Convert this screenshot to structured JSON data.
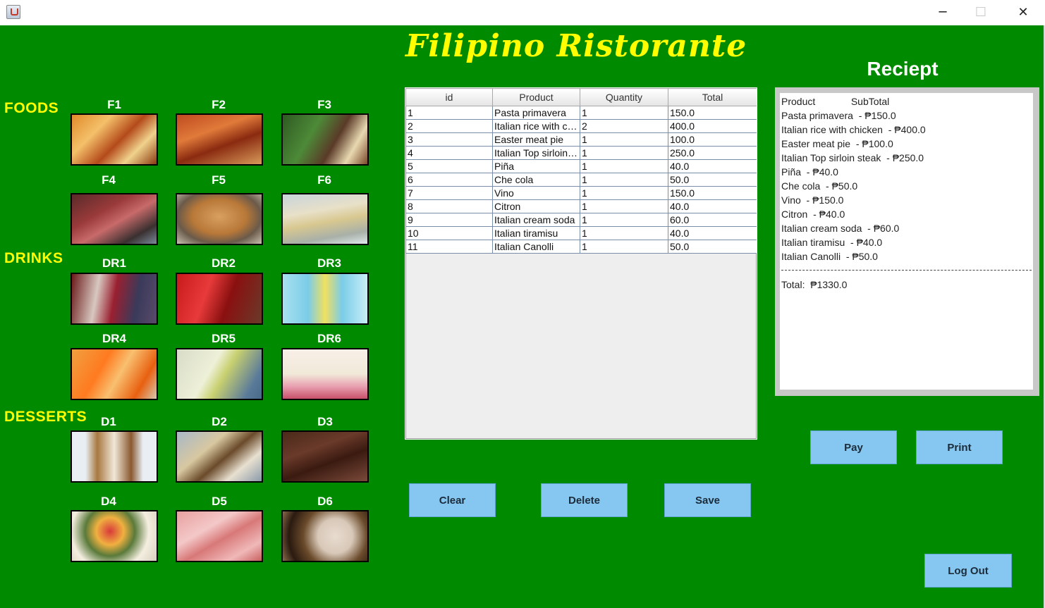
{
  "window": {
    "title": "",
    "min_icon": "─",
    "max_icon": "☐",
    "close_icon": "✕"
  },
  "app_title": "Filipino Ristorante",
  "sections": {
    "foods": "FOODS",
    "drinks": "DRINKS",
    "desserts": "DESSERTS"
  },
  "menu_items": [
    "F1",
    "F2",
    "F3",
    "F4",
    "F5",
    "F6",
    "DR1",
    "DR2",
    "DR3",
    "DR4",
    "DR5",
    "DR6",
    "D1",
    "D2",
    "D3",
    "D4",
    "D5",
    "D6"
  ],
  "table": {
    "columns": [
      "id",
      "Product",
      "Quantity",
      "Total"
    ],
    "rows": [
      [
        "1",
        "Pasta primavera",
        "1",
        "150.0"
      ],
      [
        "2",
        "Italian rice with ch...",
        "2",
        "400.0"
      ],
      [
        "3",
        "Easter meat pie",
        "1",
        "100.0"
      ],
      [
        "4",
        "Italian Top sirloin ...",
        "1",
        "250.0"
      ],
      [
        "5",
        "Piña",
        "1",
        "40.0"
      ],
      [
        "6",
        "Che cola",
        "1",
        "50.0"
      ],
      [
        "7",
        "Vino",
        "1",
        "150.0"
      ],
      [
        "8",
        "Citron",
        "1",
        "40.0"
      ],
      [
        "9",
        "Italian cream soda",
        "1",
        "60.0"
      ],
      [
        "10",
        "Italian tiramisu",
        "1",
        "40.0"
      ],
      [
        "11",
        "Italian Canolli",
        "1",
        "50.0"
      ]
    ]
  },
  "receipt": {
    "title": "Reciept",
    "header": "Product             SubTotal",
    "lines": [
      "Pasta primavera  - ₱150.0",
      "Italian rice with chicken  - ₱400.0",
      "Easter meat pie  - ₱100.0",
      "Italian Top sirloin steak  - ₱250.0",
      "Piña  - ₱40.0",
      "Che cola  - ₱50.0",
      "Vino  - ₱150.0",
      "Citron  - ₱40.0",
      "Italian cream soda  - ₱60.0",
      "Italian tiramisu  - ₱40.0",
      "Italian Canolli  - ₱50.0"
    ],
    "total": "Total:  ₱1330.0"
  },
  "buttons": {
    "clear": "Clear",
    "delete": "Delete",
    "save": "Save",
    "pay": "Pay",
    "print": "Print",
    "logout": "Log Out"
  }
}
